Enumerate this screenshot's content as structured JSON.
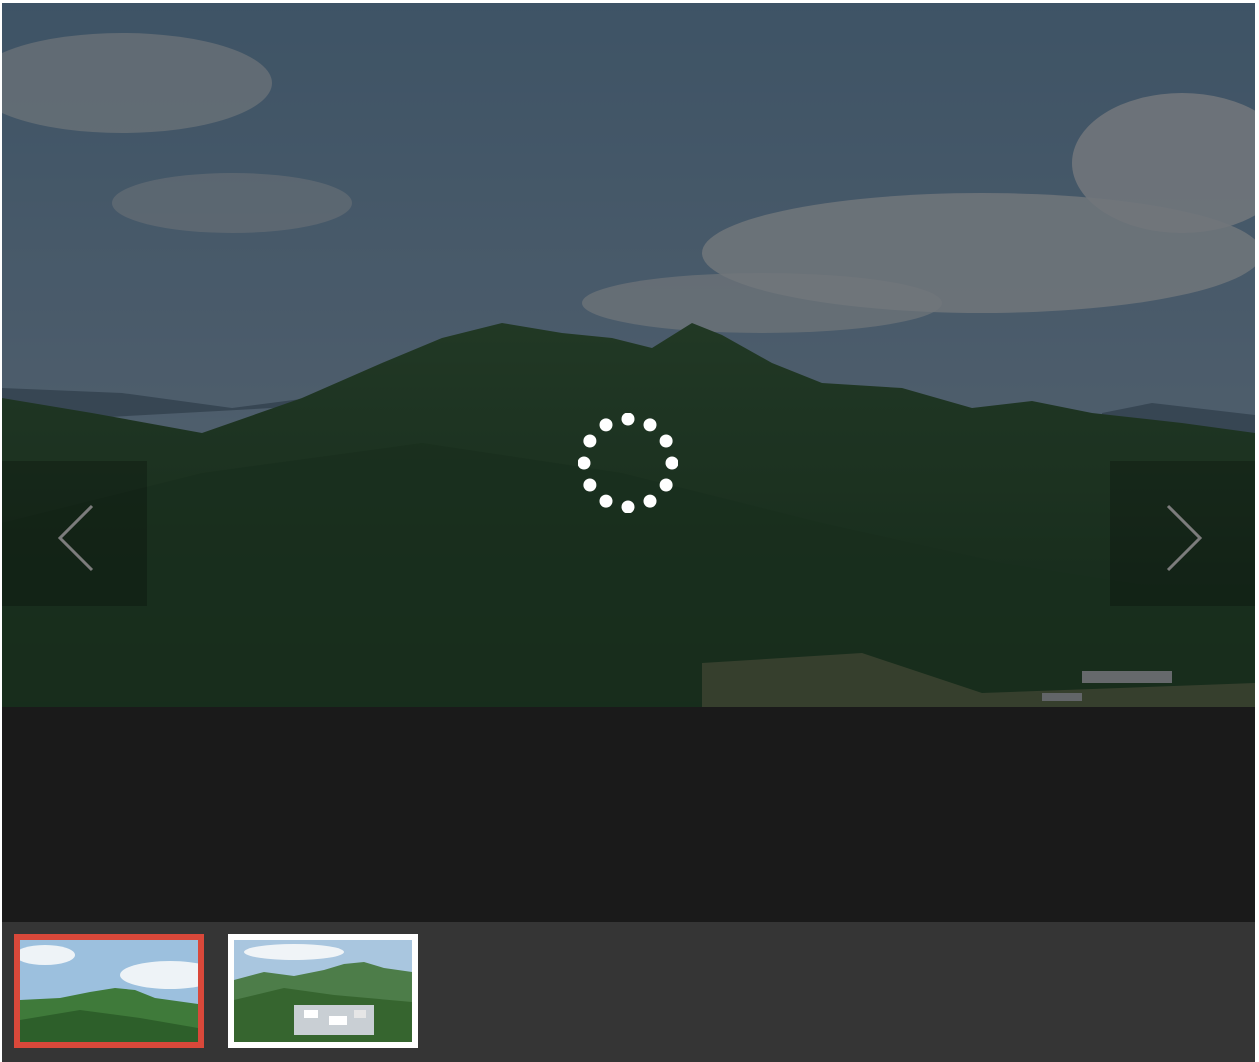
{
  "gallery": {
    "state": "loading",
    "loader_icon": "spinner-dots-icon",
    "prev_icon": "chevron-left-icon",
    "next_icon": "chevron-right-icon",
    "caption": "",
    "active_index": 0,
    "thumbnails": [
      {
        "icon": "mountain-photo-thumbnail",
        "active": true
      },
      {
        "icon": "village-photo-thumbnail",
        "active": false
      }
    ]
  },
  "colors": {
    "background": "#1a1a1a",
    "thumb_strip": "#353535",
    "active_border": "#d9483a",
    "inactive_border": "#ffffff"
  }
}
